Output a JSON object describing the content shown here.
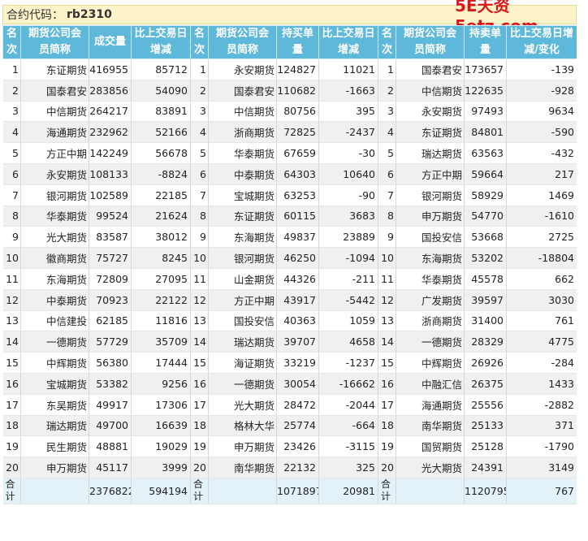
{
  "contract": {
    "label": "合约代码：",
    "code": "rb2310"
  },
  "watermark": "5E天资5etz.com",
  "headers": [
    [
      "名",
      "次"
    ],
    [
      "期货公司会",
      "员简称"
    ],
    [
      "成交量"
    ],
    [
      "比上交易日",
      "增减"
    ],
    [
      "名",
      "次"
    ],
    [
      "期货公司会",
      "员简称"
    ],
    [
      "持买单",
      "量"
    ],
    [
      "比上交易日",
      "增减"
    ],
    [
      "名",
      "次"
    ],
    [
      "期货公司会",
      "员简称"
    ],
    [
      "持卖单",
      "量"
    ],
    [
      "比上交易日增",
      "减/变化"
    ]
  ],
  "rows": [
    [
      "1",
      "东证期货",
      "416955",
      "85712",
      "1",
      "永安期货",
      "124827",
      "11021",
      "1",
      "国泰君安",
      "173657",
      "-139"
    ],
    [
      "2",
      "国泰君安",
      "283856",
      "54090",
      "2",
      "国泰君安",
      "110682",
      "-1663",
      "2",
      "中信期货",
      "122635",
      "-928"
    ],
    [
      "3",
      "中信期货",
      "264217",
      "83891",
      "3",
      "中信期货",
      "80756",
      "395",
      "3",
      "永安期货",
      "97493",
      "9634"
    ],
    [
      "4",
      "海通期货",
      "232962",
      "52166",
      "4",
      "浙商期货",
      "72825",
      "-2437",
      "4",
      "东证期货",
      "84801",
      "-590"
    ],
    [
      "5",
      "方正中期",
      "142249",
      "56678",
      "5",
      "华泰期货",
      "67659",
      "-30",
      "5",
      "瑞达期货",
      "63563",
      "-432"
    ],
    [
      "6",
      "永安期货",
      "108133",
      "-8824",
      "6",
      "中泰期货",
      "64303",
      "10640",
      "6",
      "方正中期",
      "59664",
      "217"
    ],
    [
      "7",
      "银河期货",
      "102589",
      "22185",
      "7",
      "宝城期货",
      "63253",
      "-90",
      "7",
      "银河期货",
      "58929",
      "1469"
    ],
    [
      "8",
      "华泰期货",
      "99524",
      "21624",
      "8",
      "东证期货",
      "60115",
      "3683",
      "8",
      "申万期货",
      "54770",
      "-1610"
    ],
    [
      "9",
      "光大期货",
      "83587",
      "38012",
      "9",
      "东海期货",
      "49837",
      "23889",
      "9",
      "国投安信",
      "53668",
      "2725"
    ],
    [
      "10",
      "徽商期货",
      "75727",
      "8245",
      "10",
      "银河期货",
      "46250",
      "-1094",
      "10",
      "东海期货",
      "53202",
      "-18804"
    ],
    [
      "11",
      "东海期货",
      "72809",
      "27095",
      "11",
      "山金期货",
      "44326",
      "-211",
      "11",
      "华泰期货",
      "45578",
      "662"
    ],
    [
      "12",
      "中泰期货",
      "70923",
      "22122",
      "12",
      "方正中期",
      "43917",
      "-5442",
      "12",
      "广发期货",
      "39597",
      "3030"
    ],
    [
      "13",
      "中信建投",
      "62185",
      "11816",
      "13",
      "国投安信",
      "40363",
      "1059",
      "13",
      "浙商期货",
      "31400",
      "761"
    ],
    [
      "14",
      "一德期货",
      "57729",
      "35709",
      "14",
      "瑞达期货",
      "39707",
      "4658",
      "14",
      "一德期货",
      "28329",
      "4775"
    ],
    [
      "15",
      "中辉期货",
      "56380",
      "17444",
      "15",
      "海证期货",
      "33219",
      "-1237",
      "15",
      "中辉期货",
      "26926",
      "-284"
    ],
    [
      "16",
      "宝城期货",
      "53382",
      "9256",
      "16",
      "一德期货",
      "30054",
      "-16662",
      "16",
      "中融汇信",
      "26375",
      "1433"
    ],
    [
      "17",
      "东吴期货",
      "49917",
      "17306",
      "17",
      "光大期货",
      "28472",
      "-2044",
      "17",
      "海通期货",
      "25556",
      "-2882"
    ],
    [
      "18",
      "瑞达期货",
      "49700",
      "16639",
      "18",
      "格林大华",
      "25774",
      "-664",
      "18",
      "南华期货",
      "25133",
      "371"
    ],
    [
      "19",
      "民生期货",
      "48881",
      "19029",
      "19",
      "申万期货",
      "23426",
      "-3115",
      "19",
      "国贸期货",
      "25128",
      "-1790"
    ],
    [
      "20",
      "申万期货",
      "45117",
      "3999",
      "20",
      "南华期货",
      "22132",
      "325",
      "20",
      "光大期货",
      "24391",
      "3149"
    ]
  ],
  "totals": {
    "label": "合计",
    "volume": "2376822",
    "volume_change": "594194",
    "buy": "1071897",
    "buy_change": "20981",
    "sell": "1120795",
    "sell_change": "767"
  }
}
